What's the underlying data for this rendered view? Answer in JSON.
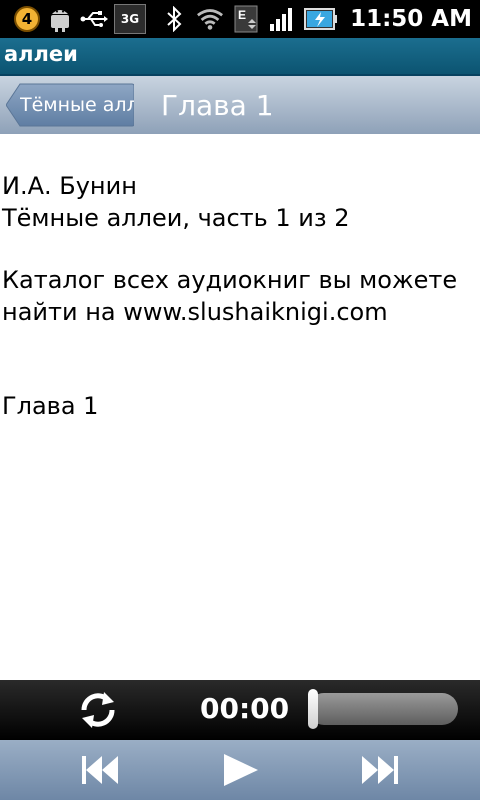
{
  "status_bar": {
    "time": "11:50 AM",
    "notification_count": "4",
    "network_type": "3G",
    "data_letter": "E",
    "icons": [
      "notification-badge-icon",
      "android-icon",
      "usb-icon",
      "3g-icon",
      "bluetooth-icon",
      "wifi-icon",
      "data-activity-icon",
      "signal-icon",
      "battery-icon"
    ]
  },
  "title_bar": {
    "title": "аллеи"
  },
  "nav_bar": {
    "back_label": "Тёмные алл",
    "title": "Глава 1"
  },
  "content": {
    "lines": [
      "И.А. Бунин",
      "Тёмные аллеи, часть 1 из 2",
      "Каталог всех аудиокниг вы можете",
      "найти на www.slushaiknigi.com",
      "Глава 1"
    ]
  },
  "player": {
    "time": "00:00",
    "progress": 0
  },
  "controls": {
    "buttons": [
      "rewind-icon",
      "play-icon",
      "fast-forward-icon"
    ]
  },
  "colors": {
    "title_bar": "#0c5471",
    "nav_bar": "#8ea1b8",
    "controls_bar": "#6e87a6",
    "player_bar": "#000000"
  }
}
